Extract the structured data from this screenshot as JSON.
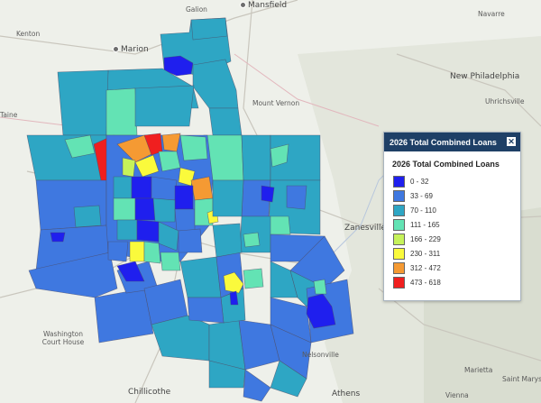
{
  "legend": {
    "header_title": "2026 Total Combined Loans",
    "close_icon": "close-icon",
    "subtitle": "2026 Total Combined Loans",
    "items": [
      {
        "label": "0 - 32",
        "color": "#1f1fee"
      },
      {
        "label": "33 - 69",
        "color": "#3f78e0"
      },
      {
        "label": "70 - 110",
        "color": "#2ea6c4"
      },
      {
        "label": "111 - 165",
        "color": "#63e3b4"
      },
      {
        "label": "166 - 229",
        "color": "#c6f25a"
      },
      {
        "label": "230 - 311",
        "color": "#fafa3c"
      },
      {
        "label": "312 - 472",
        "color": "#f59a33"
      },
      {
        "label": "473 - 618",
        "color": "#f01f1f"
      }
    ]
  },
  "places": {
    "galion": "Galion",
    "mansfield": "Mansfield",
    "kenton": "Kenton",
    "marion": "Marion",
    "navarre": "Navarre",
    "new_philadelphia": "New Philadelphia",
    "uhrichsville": "Uhrichsville",
    "mount_vernon": "Mount Vernon",
    "zanesville": "Zanesville",
    "washington_court_house": "Washington Court House",
    "chillicothe": "Chillicothe",
    "nelsonville": "Nelsonville",
    "athens": "Athens",
    "marietta": "Marietta",
    "saint_marys": "Saint Marys",
    "vienna": "Vienna",
    "taine": "Taine"
  }
}
